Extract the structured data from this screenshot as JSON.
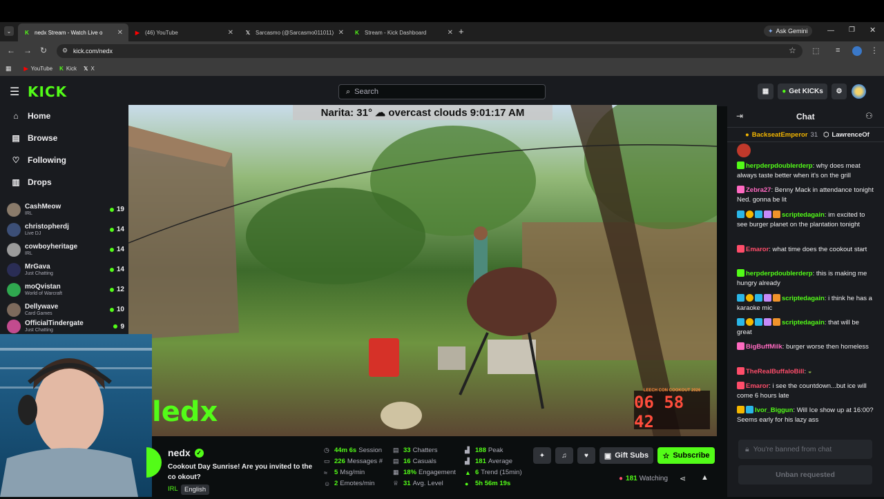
{
  "browser": {
    "tabs": [
      {
        "label": "nedx Stream - Watch Live o",
        "icon": "kick-icon",
        "color": "#53fc18"
      },
      {
        "label": "(46) YouTube",
        "icon": "youtube-icon",
        "color": "#ff0000"
      },
      {
        "label": "Sarcasmo (@Sarcasmo011011)",
        "icon": "x-icon",
        "color": "#ffffff"
      },
      {
        "label": "Stream - Kick Dashboard",
        "icon": "kick-icon",
        "color": "#53fc18"
      }
    ],
    "ask_gemini": "Ask Gemini",
    "url": "kick.com/nedx",
    "bookmarks": [
      {
        "label": "YouTube",
        "icon": "youtube-icon"
      },
      {
        "label": "Kick",
        "icon": "kick-icon"
      },
      {
        "label": "X",
        "icon": "x-icon"
      }
    ]
  },
  "header": {
    "logo": "KICK",
    "search_placeholder": "Search",
    "get_kicks": "Get KICKs"
  },
  "sidebar": {
    "nav": [
      {
        "label": "Home",
        "icon": "home-icon"
      },
      {
        "label": "Browse",
        "icon": "browse-icon"
      },
      {
        "label": "Following",
        "icon": "heart-icon"
      },
      {
        "label": "Drops",
        "icon": "drops-icon"
      }
    ],
    "channels": [
      {
        "name": "CashMeow",
        "category": "IRL",
        "viewers": "19"
      },
      {
        "name": "christopherdj",
        "category": "Live DJ",
        "viewers": "14"
      },
      {
        "name": "cowboyheritage",
        "category": "IRL",
        "viewers": "14"
      },
      {
        "name": "MrGava",
        "category": "Just Chatting",
        "viewers": "14"
      },
      {
        "name": "moQvistan",
        "category": "World of Warcraft",
        "viewers": "12"
      },
      {
        "name": "Dellywave",
        "category": "Card Games",
        "viewers": "10"
      },
      {
        "name": "OfficialTindergate",
        "category": "Just Chatting",
        "viewers": "9"
      }
    ]
  },
  "video": {
    "weather": "Narita: 31° ☁ overcast clouds 9:01:17 AM",
    "timer_label": "LEECH CON COOKOUT 2026",
    "timer": "06 58 42",
    "overlay_logo": "ledx"
  },
  "stream": {
    "channel": "nedx",
    "title": "Cookout Day Sunrise! Are you invited to the co okout?",
    "tags": [
      "IRL",
      "English"
    ],
    "stats": {
      "col1": [
        {
          "value": "44m 6s",
          "label": "Session",
          "icon": "clock-icon"
        },
        {
          "value": "226",
          "label": "Messages #",
          "icon": "message-icon"
        },
        {
          "value": "5",
          "label": "Msg/min",
          "icon": "speed-icon"
        },
        {
          "value": "2",
          "label": "Emotes/min",
          "icon": "emote-icon"
        }
      ],
      "col2": [
        {
          "value": "33",
          "label": "Chatters",
          "icon": "users-icon"
        },
        {
          "value": "16",
          "label": "Casuals",
          "icon": "users-icon"
        },
        {
          "value": "18%",
          "label": "Engagement",
          "icon": "chart-icon"
        },
        {
          "value": "31",
          "label": "Avg. Level",
          "icon": "trophy-icon"
        }
      ],
      "col3": [
        {
          "value": "188",
          "label": "Peak",
          "icon": "peak-icon"
        },
        {
          "value": "181",
          "label": "Average",
          "icon": "average-icon"
        },
        {
          "value": "6",
          "label": "Trend (15min)",
          "icon": "trend-icon"
        },
        {
          "value": "5h 56m 19s",
          "label": "",
          "icon": "dot-icon"
        }
      ]
    },
    "gift_subs": "Gift Subs",
    "subscribe": "Subscribe",
    "watching_count": "181",
    "watching_label": "Watching"
  },
  "chat": {
    "title": "Chat",
    "leaderboard": [
      {
        "name": "BackseatEmperor",
        "count": "31"
      },
      {
        "name": "LawrenceOf",
        "count": ""
      }
    ],
    "messages": [
      {
        "user": "herpderpdoublerderp",
        "color": "#53fc18",
        "text": "why does meat always taste better when it's on the grill"
      },
      {
        "user": "Zebra27",
        "color": "#ff6ac1",
        "text": "Benny Mack in attendance tonight Ned. gonna be lit"
      },
      {
        "user": "scriptedagain",
        "color": "#53fc18",
        "text": "im excited to see burger planet on the plantation tonight"
      },
      {
        "user": "Emaror",
        "color": "#ff4d6a",
        "text": "what time does the cookout start"
      },
      {
        "user": "herpderpdoublerderp",
        "color": "#53fc18",
        "text": "this is making me hungry already"
      },
      {
        "user": "scriptedagain",
        "color": "#53fc18",
        "text": "i think he has a karaoke mic"
      },
      {
        "user": "scriptedagain",
        "color": "#53fc18",
        "text": "that will be great"
      },
      {
        "user": "BigBuffMilk",
        "color": "#ff6ac1",
        "text": "burger worse then homeless"
      },
      {
        "user": "TheRealBuffaloBill",
        "color": "#ff4d6a",
        "text": ""
      },
      {
        "user": "Emaror",
        "color": "#ff4d6a",
        "text": "i see the countdown...but ice will come 6 hours late"
      },
      {
        "user": "Ivor_Biggun",
        "color": "#53fc18",
        "text": "Will Ice show up at 16:00? Seems early for his lazy ass"
      }
    ],
    "banned_placeholder": "You're banned from chat",
    "unban_label": "Unban requested"
  }
}
